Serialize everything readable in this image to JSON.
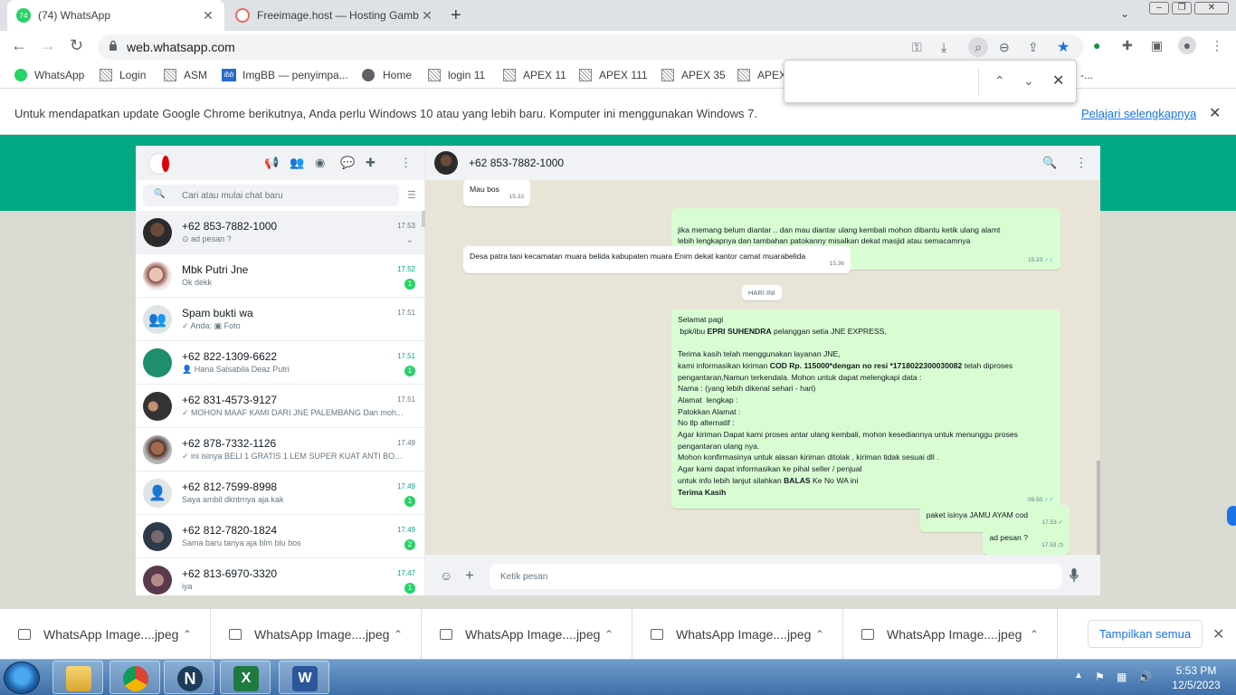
{
  "browser": {
    "tabs": [
      {
        "title": "(74) WhatsApp",
        "badge": "74",
        "active": true
      },
      {
        "title": "Freeimage.host — Hosting Gamb",
        "active": false
      }
    ],
    "url": "web.whatsapp.com",
    "bookmarks": [
      "WhatsApp",
      "Login",
      "ASM",
      "ImgBB — penyimpa...",
      "Home",
      "login 11",
      "APEX 11",
      "APEX 111",
      "APEX 35",
      "APEX"
    ],
    "bookmark_overflow": "-..."
  },
  "infobar": {
    "text": "Untuk mendapatkan update Google Chrome berikutnya, Anda perlu Windows 10 atau yang lebih baru. Komputer ini menggunakan Windows 7.",
    "link": "Pelajari selengkapnya"
  },
  "whatsapp": {
    "search_placeholder": "Cari atau mulai chat baru",
    "chats": [
      {
        "name": "+62 853-7882-1000",
        "time": "17.53",
        "preview": "⊙ ad pesan ?",
        "selected": true
      },
      {
        "name": "Mbk Putri Jne",
        "time": "17.52",
        "preview": "Ok dekk",
        "unread": "1"
      },
      {
        "name": "Spam bukti wa",
        "time": "17.51",
        "preview": "✓ Anda: ▣ Foto"
      },
      {
        "name": "+62 822-1309-6622",
        "time": "17.51",
        "preview": "👤 Hana Salsabila Deaz Putri",
        "unread": "1"
      },
      {
        "name": "+62 831-4573-9127",
        "time": "17.51",
        "preview": "✓ MOHON MAAF KAMI DARI JNE PALEMBANG   Dan moh..."
      },
      {
        "name": "+62 878-7332-1126",
        "time": "17.49",
        "preview": "✓ ini isinya BELI 1 GRATIS 1 LEM SUPER KUAT ANTI BOCOR..."
      },
      {
        "name": "+62 812-7599-8998",
        "time": "17.49",
        "preview": "Saya ambil dkntrnya aja kak",
        "unread": "1"
      },
      {
        "name": "+62 812-7820-1824",
        "time": "17.49",
        "preview": "Sama baru tanya aja blm blu bos",
        "unread": "2"
      },
      {
        "name": "+62 813-6970-3320",
        "time": "17.47",
        "preview": "iya",
        "unread": "1"
      }
    ],
    "conversation": {
      "contact": "+62 853-7882-1000",
      "day_label": "HARI INI",
      "input_placeholder": "Ketik pesan",
      "messages": [
        {
          "dir": "in",
          "text": "Mau bos",
          "time": "15.33"
        },
        {
          "dir": "out",
          "text": "jika memang belum diantar .. dan mau diantar ulang   kembali mohon dibantu ketik ulang alamt\nlebih lengkapnya dan tambahan patokanny misalkan dekat masjid atau semacamnya",
          "time": "15.33"
        },
        {
          "dir": "in",
          "text": "Desa patra tani kecamatan muara belida kabupaten muara Enim dekat kantor camat muarabelida",
          "time": "15.36"
        },
        {
          "dir": "out",
          "text": "paket isinya JAMU AYAM cod",
          "time": "17.53"
        },
        {
          "dir": "out",
          "text": "ad pesan ?",
          "time": "17.53"
        }
      ],
      "jne_message": {
        "time": "09.50",
        "greeting": "Selamat pagi",
        "line2_pre": " bpk/ibu ",
        "line2_bold": "EPRI SUHENDRA",
        "line2_post": " pelanggan setia JNE EXPRESS,",
        "thanks": "Terima kasih telah menggunakan layanan JNE,",
        "info_pre": "kami informasikan kiriman ",
        "info_bold": "COD  Rp. 115000*dengan no resi *1718022300030082",
        "info_post": " telah diproses pengantaran,Namun terkendala. Mohon untuk dapat melengkapi data :",
        "fields": [
          "Nama : (yang lebih dikenal sehari - hari)",
          "Alamat  lengkap :",
          "Patokkan Alamat :",
          "No tlp alternatif :"
        ],
        "body": "Agar kiriman Dapat kami proses antar ulang kembali, mohon kesediannya untuk menunggu proses pengantaran ulang nya.\nMohon konfirmasinya untuk alasan kiriman ditolak , kiriman tidak sesuai dll .\nAgar kami dapat informasikan ke pihal seller / penjual",
        "balas_pre": "untuk info lebih lanjut silahkan ",
        "balas_bold": "BALAS",
        "balas_post": " Ke No WA ini",
        "closing": "Terima Kasih"
      }
    }
  },
  "downloads": {
    "items": [
      "WhatsApp Image....jpeg",
      "WhatsApp Image....jpeg",
      "WhatsApp Image....jpeg",
      "WhatsApp Image....jpeg",
      "WhatsApp Image....jpeg"
    ],
    "show_all": "Tampilkan semua"
  },
  "taskbar": {
    "time": "5:53 PM",
    "date": "12/5/2023"
  },
  "colors": {
    "wa_green": "#00a884",
    "bubble_out": "#d9fdd3",
    "link_blue": "#1a73e8"
  }
}
